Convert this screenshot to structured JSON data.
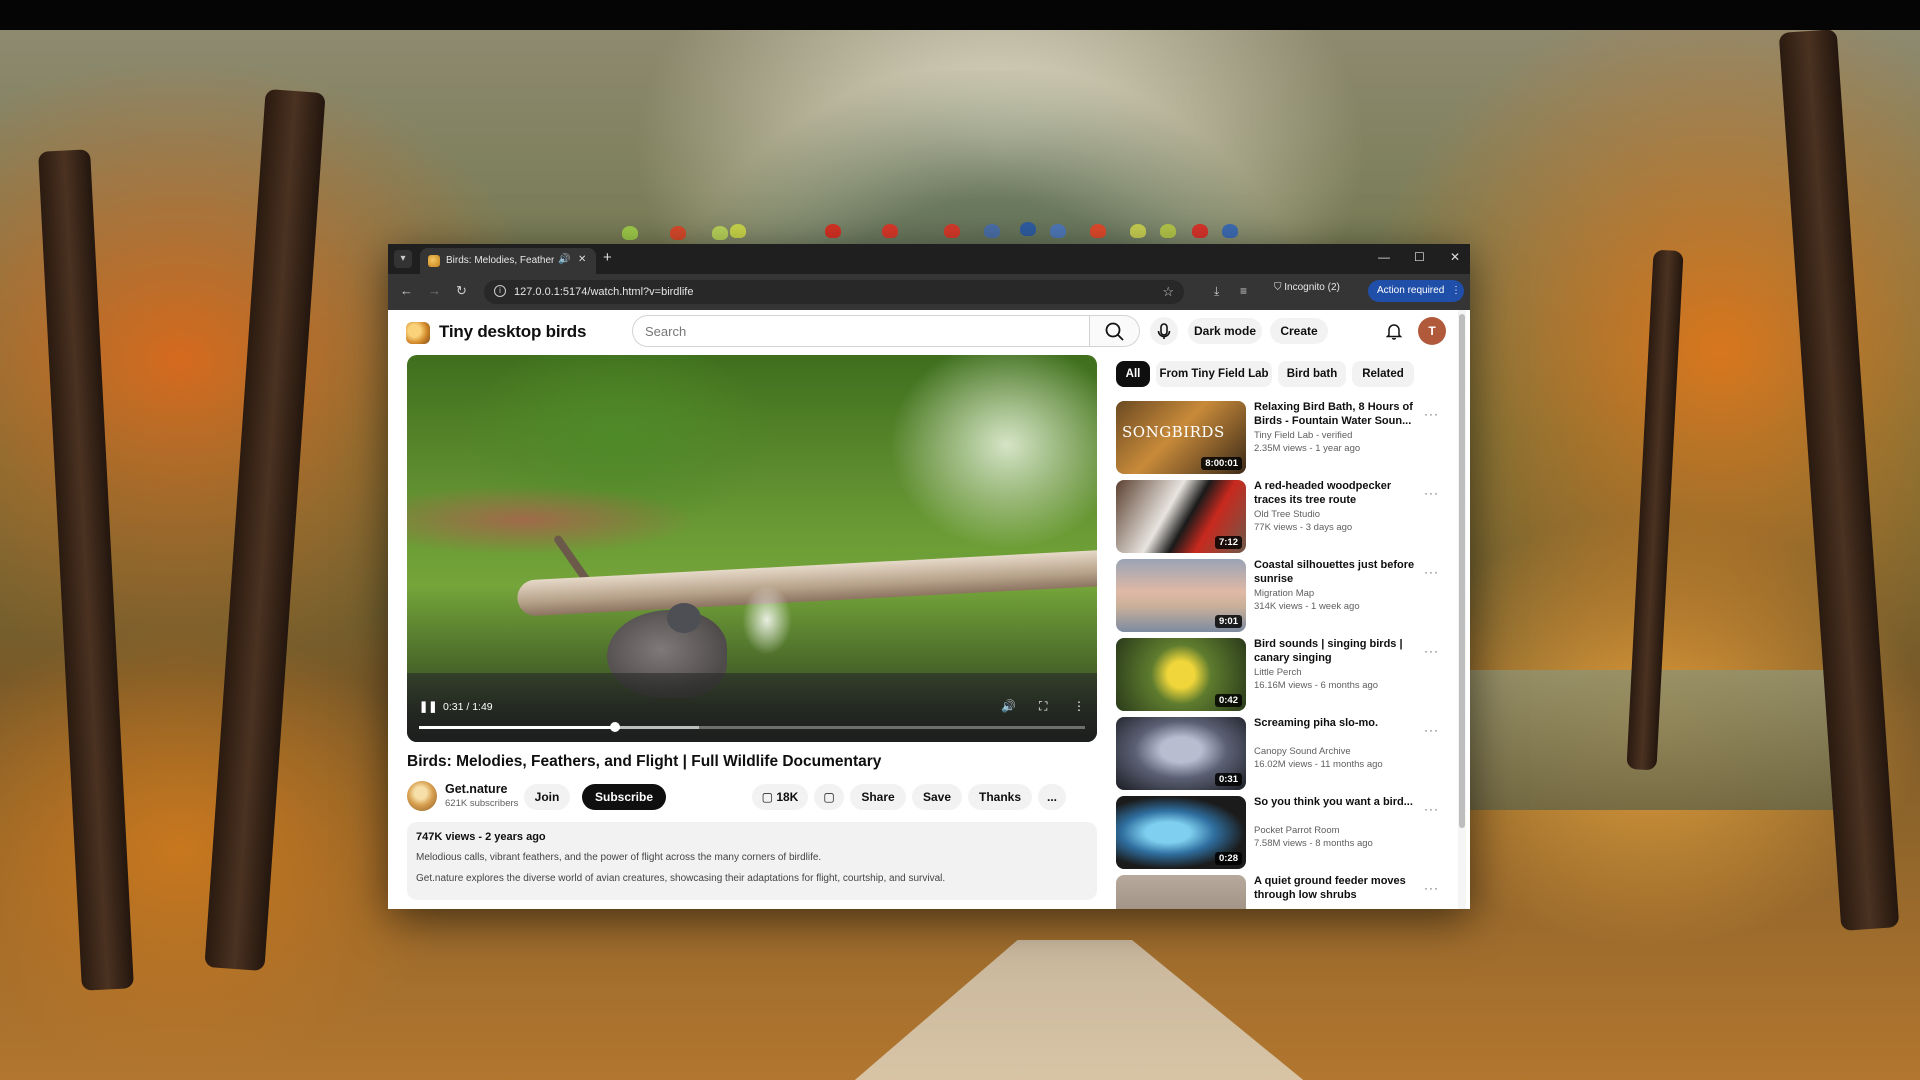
{
  "browser": {
    "tab_title": "Birds: Melodies, Feathers, and Flight | Full Wildlife Documentary",
    "url": "127.0.0.1:5174/watch.html?v=birdlife",
    "incognito_label": "Incognito (2)",
    "action_label": "Action required"
  },
  "site": {
    "name": "Tiny desktop birds",
    "search_placeholder": "Search",
    "dark_mode_label": "Dark mode",
    "create_label": "Create",
    "avatar_letter": "T"
  },
  "player": {
    "time": "0:31 / 1:49",
    "progress": 0.295,
    "buffered": 0.42
  },
  "video": {
    "title": "Birds: Melodies, Feathers, and Flight | Full Wildlife Documentary",
    "channel": "Get.nature",
    "subscribers": "621K subscribers",
    "join_label": "Join",
    "subscribe_label": "Subscribe",
    "likes": "18K",
    "share_label": "Share",
    "save_label": "Save",
    "thanks_label": "Thanks",
    "more_label": "...",
    "description": {
      "meta": "747K views - 2 years ago",
      "line1": "Melodious calls, vibrant feathers, and the power of flight across the many corners of birdlife.",
      "line2": "Get.nature explores the diverse world of avian creatures, showcasing their adaptations for flight, courtship, and survival."
    }
  },
  "chips": [
    "All",
    "From Tiny Field Lab",
    "Bird bath",
    "Related"
  ],
  "recommendations": [
    {
      "title": "Relaxing Bird Bath, 8 Hours of Birds - Fountain Water Soun...",
      "channel": "Tiny Field Lab - verified",
      "meta": "2.35M views - 1 year ago",
      "duration": "8:00:01",
      "thumb_text": "SONGBIRDS"
    },
    {
      "title": "A red-headed woodpecker traces its tree route",
      "channel": "Old Tree Studio",
      "meta": "77K views - 3 days ago",
      "duration": "7:12"
    },
    {
      "title": "Coastal silhouettes just before sunrise",
      "channel": "Migration Map",
      "meta": "314K views - 1 week ago",
      "duration": "9:01"
    },
    {
      "title": "Bird sounds | singing birds | canary singing",
      "channel": "Little Perch",
      "meta": "16.16M views - 6 months ago",
      "duration": "0:42"
    },
    {
      "title": "Screaming piha slo-mo.",
      "channel": "Canopy Sound Archive",
      "meta": "16.02M views - 11 months ago",
      "duration": "0:31"
    },
    {
      "title": "So you think you want a bird...",
      "channel": "Pocket Parrot Room",
      "meta": "7.58M views - 8 months ago",
      "duration": "0:28"
    },
    {
      "title": "A quiet ground feeder moves through low shrubs",
      "channel": "",
      "meta": "",
      "duration": ""
    }
  ],
  "colors": {
    "subscribe_bg": "#0f0f0f",
    "action_required": "#1f4fa8",
    "chrome_dark": "#1f1f1f"
  }
}
